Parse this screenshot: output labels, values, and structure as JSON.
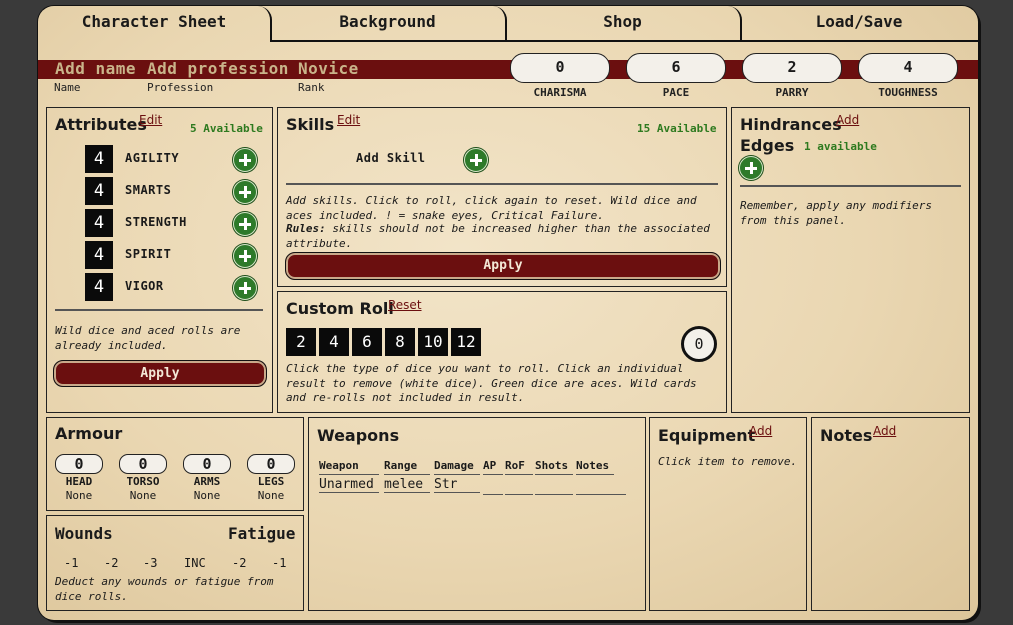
{
  "tabs": [
    "Character Sheet",
    "Background",
    "Shop",
    "Load/Save"
  ],
  "header": {
    "name_placeholder": "Add name",
    "profession_placeholder": "Add profession",
    "rank": "Novice",
    "name_label": "Name",
    "profession_label": "Profession",
    "rank_label": "Rank"
  },
  "stats": [
    {
      "label": "CHARISMA",
      "value": "0"
    },
    {
      "label": "PACE",
      "value": "6"
    },
    {
      "label": "PARRY",
      "value": "2"
    },
    {
      "label": "TOUGHNESS",
      "value": "4"
    }
  ],
  "attributes": {
    "title": "Attributes",
    "edit": "Edit",
    "available": "5 Available",
    "items": [
      {
        "name": "AGILITY",
        "value": "4"
      },
      {
        "name": "SMARTS",
        "value": "4"
      },
      {
        "name": "STRENGTH",
        "value": "4"
      },
      {
        "name": "SPIRIT",
        "value": "4"
      },
      {
        "name": "VIGOR",
        "value": "4"
      }
    ],
    "note": "Wild dice and aced rolls are already included.",
    "apply": "Apply"
  },
  "skills": {
    "title": "Skills",
    "edit": "Edit",
    "available": "15 Available",
    "add_skill": "Add Skill",
    "note": "Add skills. Click to roll, click again to reset. Wild dice and aces included. ! = snake eyes, Critical Failure.",
    "rules_label": "Rules:",
    "rules_text": "skills should not be increased higher than the associated attribute.",
    "apply": "Apply"
  },
  "custom_roll": {
    "title": "Custom Roll",
    "reset": "Reset",
    "dice": [
      "2",
      "4",
      "6",
      "8",
      "10",
      "12"
    ],
    "result": "0",
    "note": "Click the type of dice you want to roll. Click an individual result to remove (white dice). Green dice are aces. Wild cards and re-rolls not included in result."
  },
  "hindrances": {
    "title": "Hindrances",
    "add": "Add"
  },
  "edges": {
    "title": "Edges",
    "available": "1 available",
    "note": "Remember, apply any modifiers from this panel."
  },
  "armour": {
    "title": "Armour",
    "slots": [
      {
        "label": "HEAD",
        "value": "0",
        "item": "None"
      },
      {
        "label": "TORSO",
        "value": "0",
        "item": "None"
      },
      {
        "label": "ARMS",
        "value": "0",
        "item": "None"
      },
      {
        "label": "LEGS",
        "value": "0",
        "item": "None"
      }
    ]
  },
  "wounds": {
    "title": "Wounds",
    "fatigue_title": "Fatigue",
    "wound_levels": [
      "-1",
      "-2",
      "-3",
      "INC"
    ],
    "fatigue_levels": [
      "-2",
      "-1"
    ],
    "note": "Deduct any wounds or fatigue from dice rolls."
  },
  "weapons": {
    "title": "Weapons",
    "headers": [
      "Weapon",
      "Range",
      "Damage",
      "AP",
      "RoF",
      "Shots",
      "Notes"
    ],
    "rows": [
      [
        "Unarmed",
        "melee",
        "Str",
        "",
        "",
        "",
        ""
      ]
    ]
  },
  "equipment": {
    "title": "Equipment",
    "add": "Add",
    "note": "Click item to remove."
  },
  "notes": {
    "title": "Notes",
    "add": "Add"
  }
}
